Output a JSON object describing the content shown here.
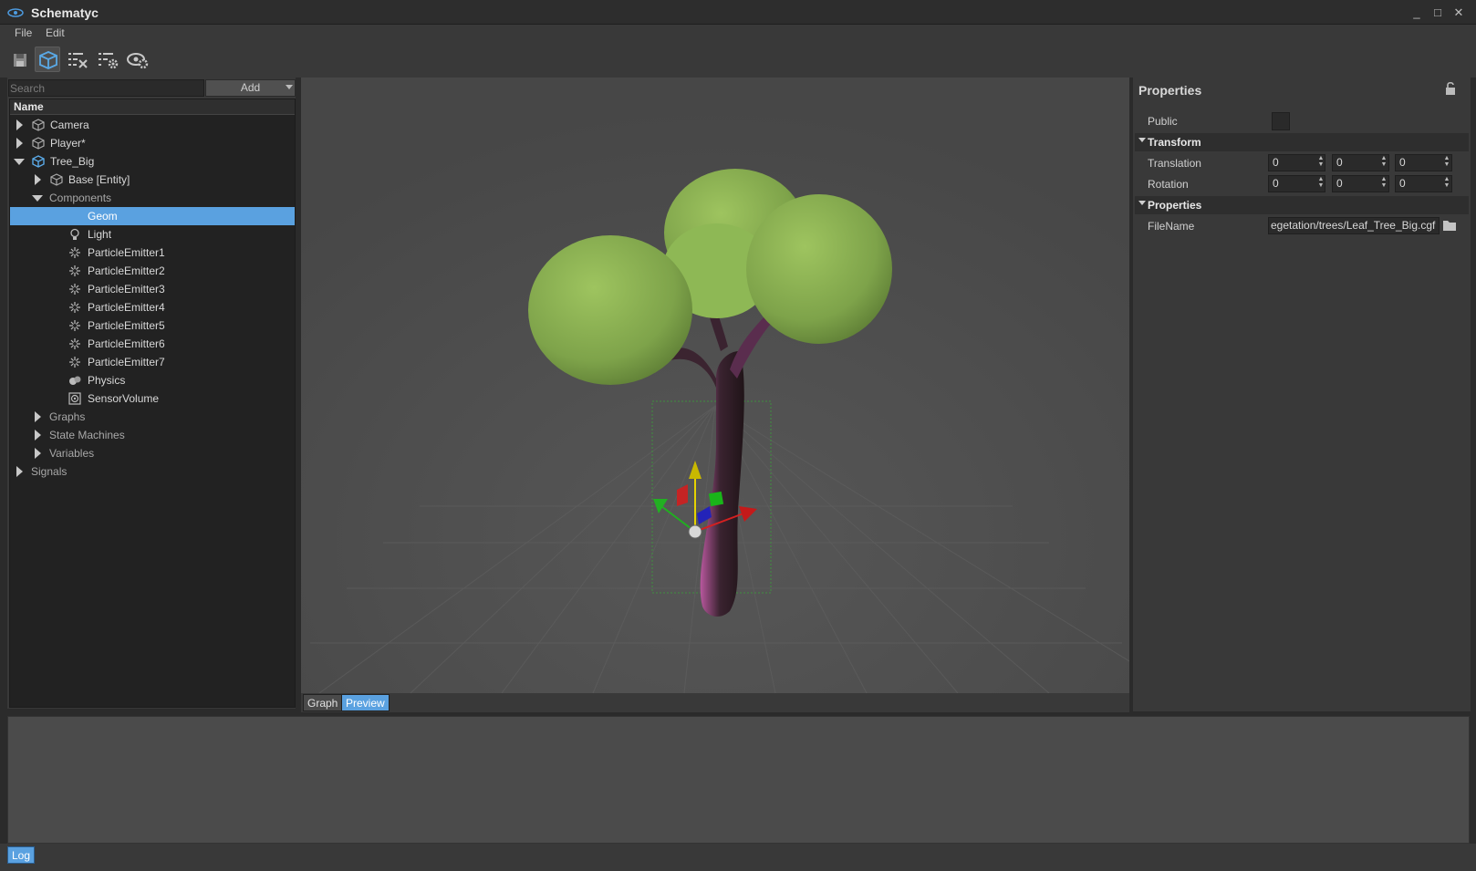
{
  "app": {
    "title": "Schematyc"
  },
  "window_controls": {
    "minimize": "_",
    "maximize": "□",
    "close": "✕"
  },
  "menu": {
    "file": "File",
    "edit": "Edit"
  },
  "toolbar": {
    "icons": [
      "save-icon",
      "entity-cube-icon",
      "remove-list-icon",
      "list-settings-icon",
      "preview-settings-icon"
    ]
  },
  "left": {
    "search_placeholder": "Search",
    "add_label": "Add",
    "header": "Name",
    "items": [
      {
        "label": "Camera",
        "icon": "entity-cube-icon"
      },
      {
        "label": "Player*",
        "icon": "entity-cube-icon"
      },
      {
        "label": "Tree_Big",
        "icon": "entity-cube-blue-icon"
      },
      {
        "label": "Base [Entity]",
        "icon": "entity-cube-icon"
      },
      {
        "label": "Components"
      },
      {
        "label": "Geom"
      },
      {
        "label": "Light",
        "icon": "light-bulb-icon"
      },
      {
        "label": "ParticleEmitter1",
        "icon": "particle-icon"
      },
      {
        "label": "ParticleEmitter2",
        "icon": "particle-icon"
      },
      {
        "label": "ParticleEmitter3",
        "icon": "particle-icon"
      },
      {
        "label": "ParticleEmitter4",
        "icon": "particle-icon"
      },
      {
        "label": "ParticleEmitter5",
        "icon": "particle-icon"
      },
      {
        "label": "ParticleEmitter6",
        "icon": "particle-icon"
      },
      {
        "label": "ParticleEmitter7",
        "icon": "particle-icon"
      },
      {
        "label": "Physics",
        "icon": "physics-icon"
      },
      {
        "label": "SensorVolume",
        "icon": "sensor-volume-icon"
      },
      {
        "label": "Graphs"
      },
      {
        "label": "State Machines"
      },
      {
        "label": "Variables"
      },
      {
        "label": "Signals"
      }
    ],
    "selected": "Geom"
  },
  "viewport": {
    "tabs": {
      "graph": "Graph",
      "preview": "Preview"
    },
    "active_tab": "Preview"
  },
  "properties": {
    "title": "Properties",
    "public_label": "Public",
    "transform_section": "Transform",
    "translation_label": "Translation",
    "translation": [
      "0",
      "0",
      "0"
    ],
    "rotation_label": "Rotation",
    "rotation": [
      "0",
      "0",
      "0"
    ],
    "props_section": "Properties",
    "filename_label": "FileName",
    "filename_value": "egetation/trees/Leaf_Tree_Big.cgf"
  },
  "log": {
    "tab": "Log"
  },
  "colors": {
    "accent": "#5aa1e0",
    "panel": "#393939",
    "tree_bg": "#222222"
  }
}
